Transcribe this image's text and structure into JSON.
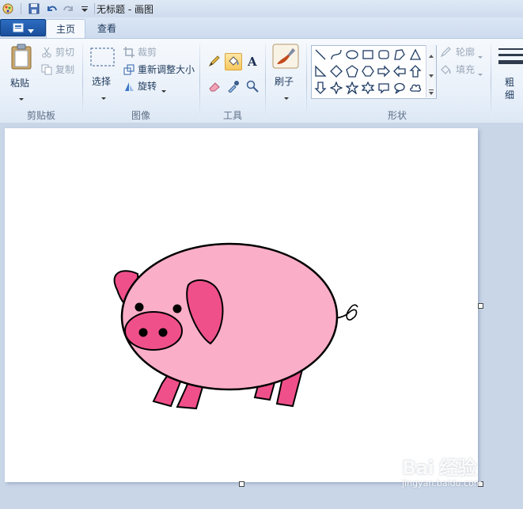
{
  "window": {
    "title": "无标题 - 画图"
  },
  "tabs": [
    {
      "label": "主页"
    },
    {
      "label": "查看"
    }
  ],
  "clipboard": {
    "paste": "粘贴",
    "cut": "剪切",
    "copy": "复制",
    "group": "剪贴板"
  },
  "image": {
    "select": "选择",
    "crop": "裁剪",
    "resize": "重新调整大小",
    "rotate": "旋转",
    "group": "图像"
  },
  "tools": {
    "group": "工具",
    "active": "fill-bucket"
  },
  "brushes": {
    "label": "刷子"
  },
  "shapes": {
    "outline": "轮廓",
    "fill": "填充",
    "group": "形状"
  },
  "size": {
    "label_1": "粗",
    "label_2": "细"
  },
  "watermark": {
    "line1": "Bai 经验",
    "line2": "jingyan.baidu.com"
  },
  "colors": {
    "pig_body": "#fbaec8",
    "pig_dark": "#f0508a",
    "outline": "#000000",
    "canvas": "#ffffff"
  }
}
